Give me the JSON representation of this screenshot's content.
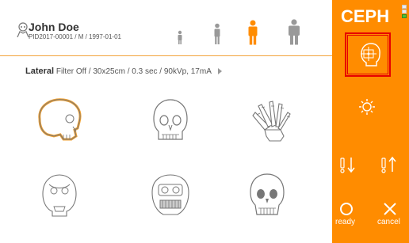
{
  "patient": {
    "name": "John Doe",
    "info": "PID2017-00001 / M / 1997-01-01"
  },
  "age_groups": [
    {
      "name": "child-small",
      "selected": false
    },
    {
      "name": "child",
      "selected": false
    },
    {
      "name": "adult-medium",
      "selected": true
    },
    {
      "name": "adult-large",
      "selected": false
    }
  ],
  "mode": {
    "label": "Lateral",
    "details": "Filter Off / 30x25cm / 0.3 sec / 90kVp, 17mA"
  },
  "projections": [
    {
      "name": "lateral",
      "selected": true
    },
    {
      "name": "pa",
      "selected": false
    },
    {
      "name": "hand",
      "selected": false
    },
    {
      "name": "ap",
      "selected": false
    },
    {
      "name": "waters",
      "selected": false
    },
    {
      "name": "skull-ap",
      "selected": false
    }
  ],
  "panel": {
    "logo": "CEPH",
    "ready_label": "ready",
    "cancel_label": "cancel",
    "status_leds": [
      false,
      false,
      true
    ]
  },
  "colors": {
    "accent": "#ff8c00",
    "selected_outline": "#f0a030",
    "highlight": "#e60000"
  }
}
